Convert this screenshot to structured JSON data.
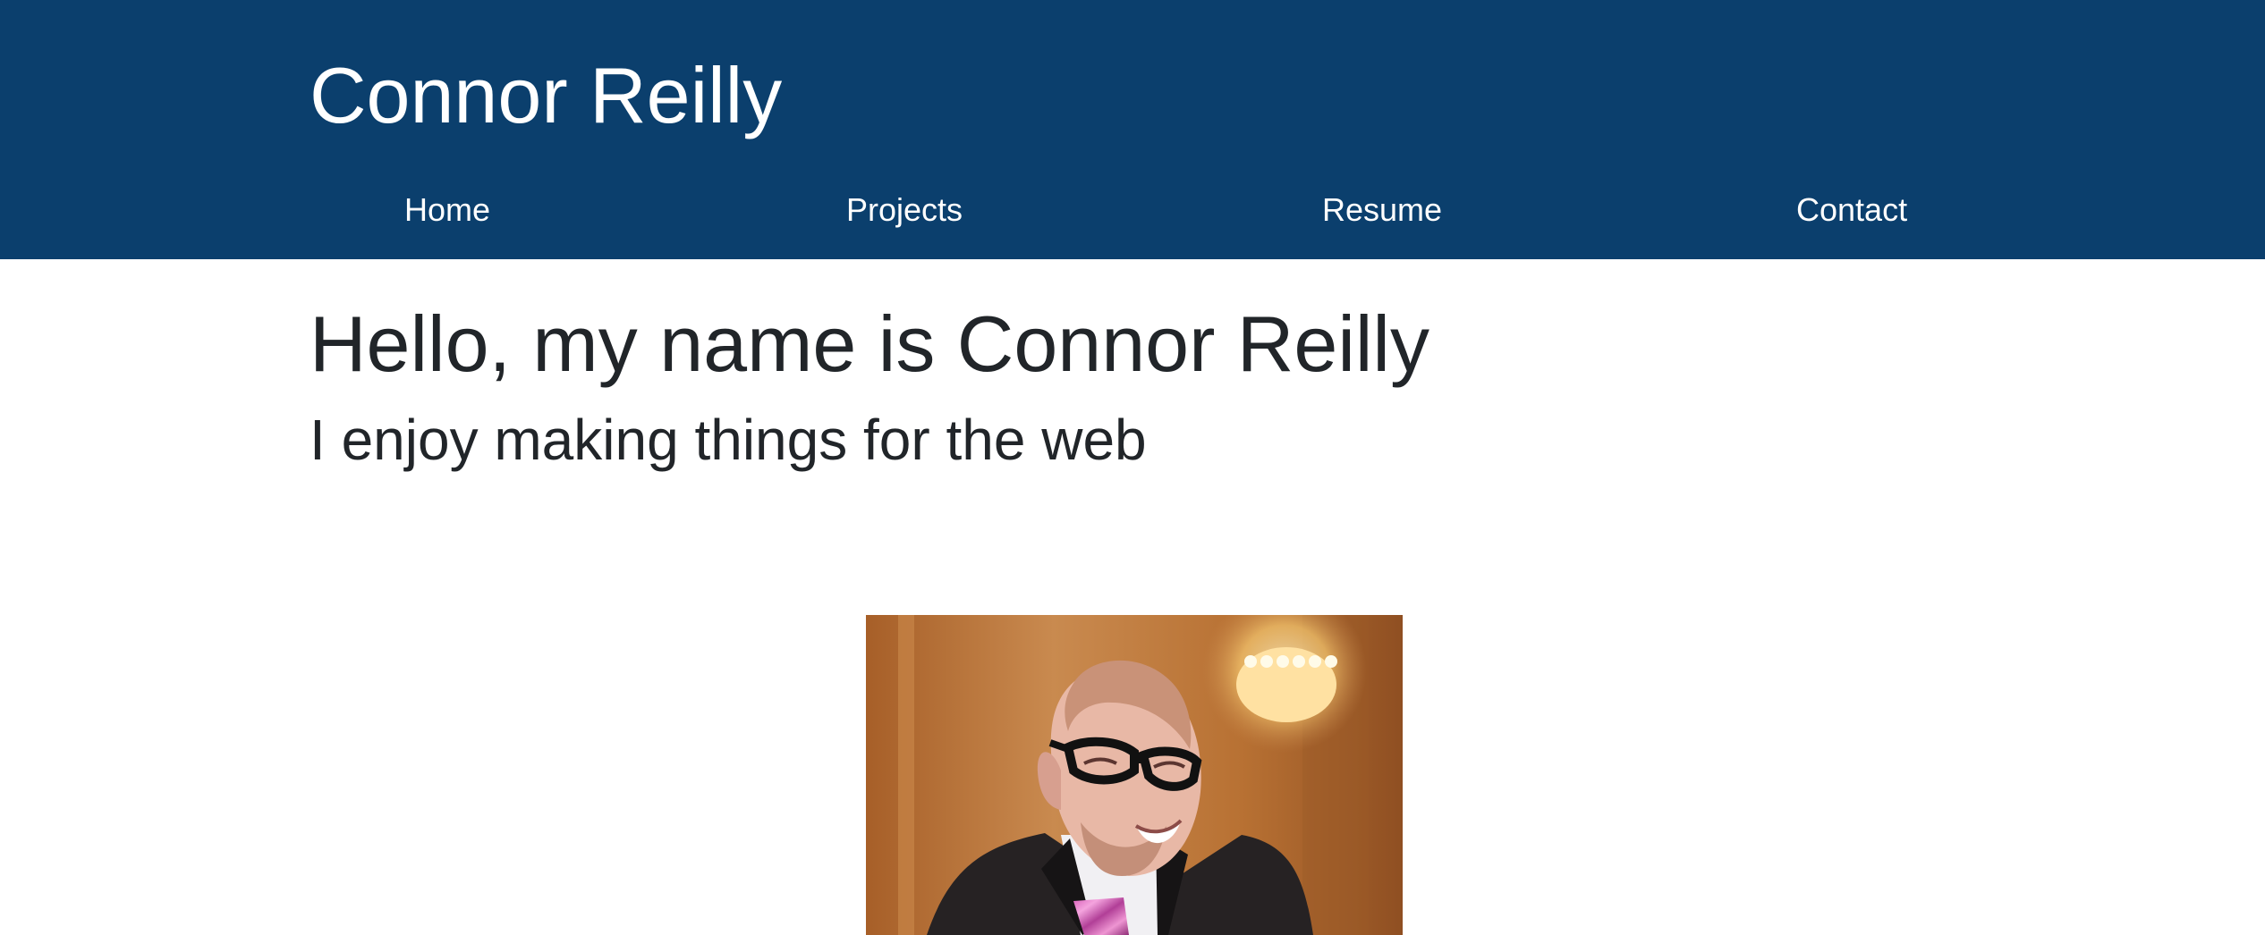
{
  "header": {
    "title": "Connor Reilly",
    "background_color": "#0b3f6d",
    "nav": [
      {
        "label": "Home"
      },
      {
        "label": "Projects"
      },
      {
        "label": "Resume"
      },
      {
        "label": "Contact"
      }
    ]
  },
  "hero": {
    "heading": "Hello, my name is Connor Reilly",
    "subheading": "I enjoy making things for the web"
  },
  "colors": {
    "header_text": "#ffffff",
    "body_text": "#212529"
  }
}
